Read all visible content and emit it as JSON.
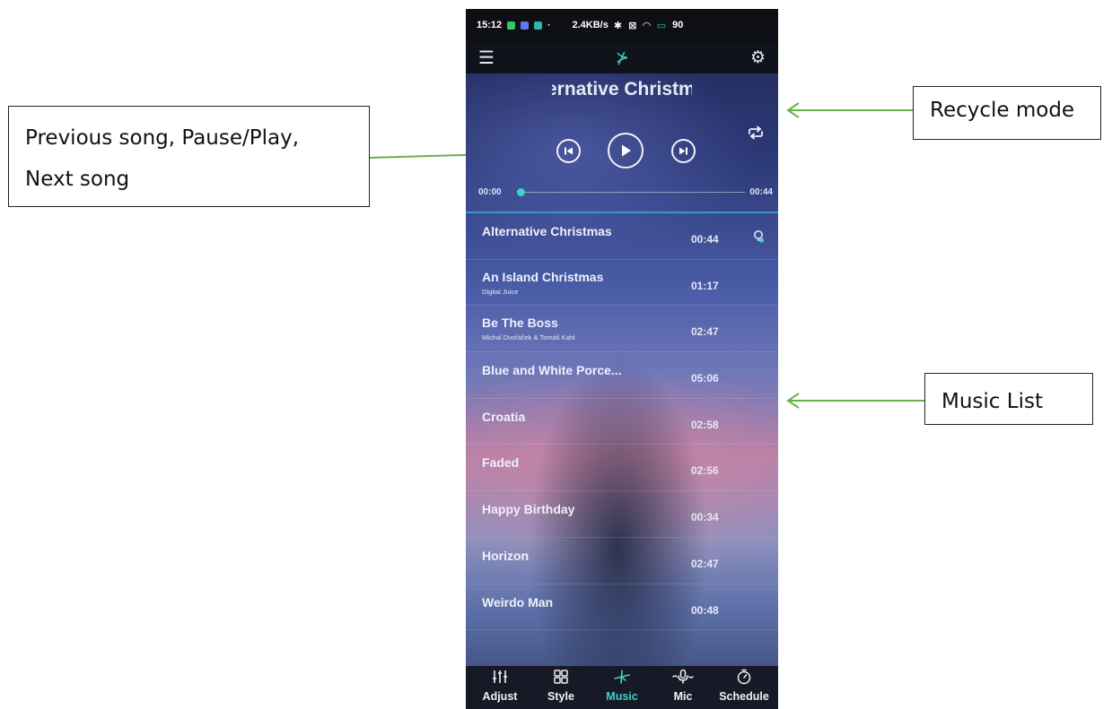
{
  "callouts": {
    "controls_line1": "Previous song, Pause/Play,",
    "controls_line2": "Next song",
    "recycle": "Recycle mode",
    "music_list": "Music List"
  },
  "status_bar": {
    "time": "15:12",
    "network_speed": "2.4KB/s",
    "battery": "90"
  },
  "app_bar": {
    "menu_icon": "menu-icon",
    "logo_icon": "music-logo-icon",
    "settings_icon": "gear-icon"
  },
  "player": {
    "title_visible": "Alternative Christmas",
    "repeat_icon": "repeat-icon",
    "current_time": "00:00",
    "total_time": "00:44",
    "progress_fraction": 0.0
  },
  "tracks": [
    {
      "name": "Alternative Christmas",
      "artist": "",
      "duration": "00:44",
      "playing": true
    },
    {
      "name": "An Island Christmas",
      "artist": "Digital Juice",
      "duration": "01:17",
      "playing": false
    },
    {
      "name": "Be The Boss",
      "artist": "Michal Dvořáček & Tomáš Kahl",
      "duration": "02:47",
      "playing": false
    },
    {
      "name": "Blue and White Porce...",
      "artist": "",
      "duration": "05:06",
      "playing": false
    },
    {
      "name": "Croatia",
      "artist": "",
      "duration": "02:58",
      "playing": false
    },
    {
      "name": "Faded",
      "artist": "",
      "duration": "02:56",
      "playing": false
    },
    {
      "name": "Happy Birthday",
      "artist": "",
      "duration": "00:34",
      "playing": false
    },
    {
      "name": "Horizon",
      "artist": "",
      "duration": "02:47",
      "playing": false
    },
    {
      "name": "Weirdo Man",
      "artist": "",
      "duration": "00:48",
      "playing": false
    }
  ],
  "bottom_nav": [
    {
      "label": "Adjust",
      "icon": "sliders-icon",
      "active": false
    },
    {
      "label": "Style",
      "icon": "grid-icon",
      "active": false
    },
    {
      "label": "Music",
      "icon": "music-logo-icon",
      "active": true
    },
    {
      "label": "Mic",
      "icon": "mic-icon",
      "active": false
    },
    {
      "label": "Schedule",
      "icon": "timer-icon",
      "active": false
    }
  ],
  "colors": {
    "accent": "#3fd3c6",
    "arrow": "#6ab04c",
    "bar_bg": "#10121c"
  }
}
